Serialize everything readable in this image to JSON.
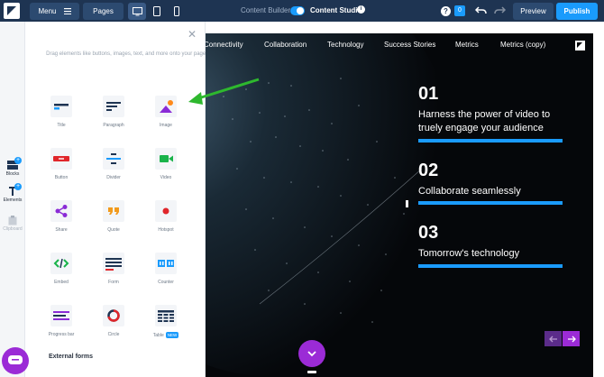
{
  "topbar": {
    "menu_label": "Menu",
    "pages_label": "Pages",
    "content_builder_label": "Content Builder",
    "content_studio_label": "Content Studio",
    "chat_count": "0",
    "preview_label": "Preview",
    "publish_label": "Publish"
  },
  "rail": {
    "blocks_label": "Blocks",
    "elements_label": "Elements",
    "clipboard_label": "Clipboard"
  },
  "panel": {
    "hint": "Drag elements like buttons, images, text, and more onto your page.",
    "tiles": [
      {
        "label": "Title"
      },
      {
        "label": "Paragraph"
      },
      {
        "label": "Image"
      },
      {
        "label": "Button"
      },
      {
        "label": "Divider"
      },
      {
        "label": "Video"
      },
      {
        "label": "Share"
      },
      {
        "label": "Quote"
      },
      {
        "label": "Hotspot"
      },
      {
        "label": "Embed"
      },
      {
        "label": "Form"
      },
      {
        "label": "Counter"
      },
      {
        "label": "Progress bar"
      },
      {
        "label": "Circle"
      },
      {
        "label": "Table",
        "badge": "NEW"
      }
    ],
    "external_forms_label": "External forms"
  },
  "canvas": {
    "nav": [
      "Connectivity",
      "Collaboration",
      "Technology",
      "Success Stories",
      "Metrics",
      "Metrics (copy)"
    ],
    "steps": [
      {
        "num": "01",
        "text": "Harness the power of video to truely engage your audience"
      },
      {
        "num": "02",
        "text": "Collaborate seamlessly"
      },
      {
        "num": "03",
        "text": "Tomorrow's technology"
      }
    ]
  },
  "colors": {
    "topbar": "#1e3452",
    "accent": "#1a9bfc",
    "purple": "#9b2bd6",
    "annotation_arrow": "#2eb82e"
  }
}
